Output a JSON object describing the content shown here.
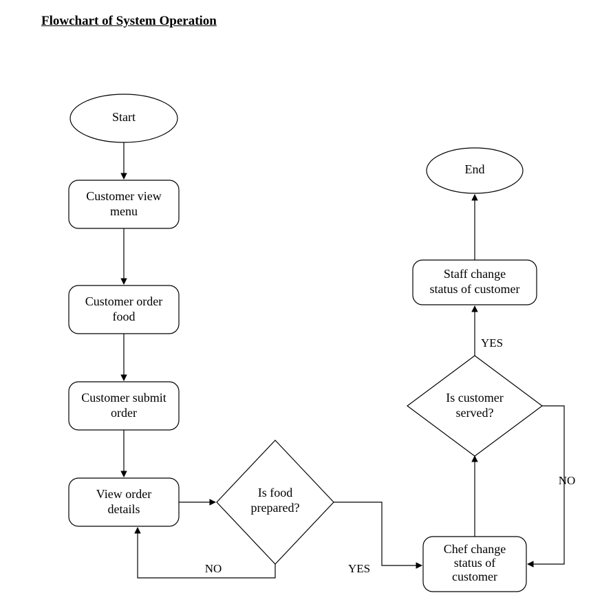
{
  "title": "Flowchart of System Operation",
  "nodes": {
    "start": "Start",
    "view_menu_l1": "Customer view",
    "view_menu_l2": "menu",
    "order_food_l1": "Customer order",
    "order_food_l2": "food",
    "submit_order_l1": "Customer submit",
    "submit_order_l2": "order",
    "view_details_l1": "View order",
    "view_details_l2": "details",
    "is_food_prepared_l1": "Is food",
    "is_food_prepared_l2": "prepared?",
    "chef_change_l1": "Chef change",
    "chef_change_l2": "status of",
    "chef_change_l3": "customer",
    "is_customer_served_l1": "Is customer",
    "is_customer_served_l2": "served?",
    "staff_change_l1": "Staff change",
    "staff_change_l2": "status of customer",
    "end": "End"
  },
  "edges": {
    "yes": "YES",
    "no": "NO"
  }
}
